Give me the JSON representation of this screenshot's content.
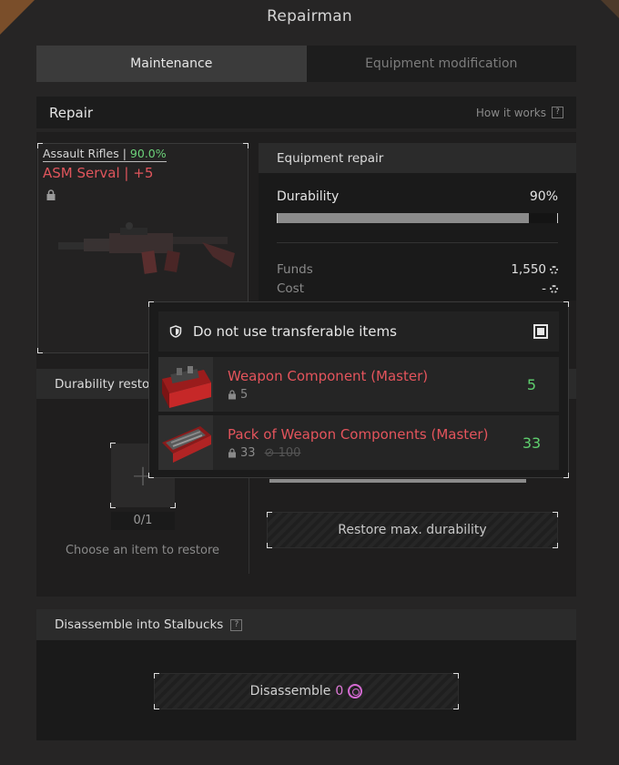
{
  "window": {
    "title": "Repairman"
  },
  "tabs": [
    {
      "label": "Maintenance",
      "active": true
    },
    {
      "label": "Equipment modification",
      "active": false
    }
  ],
  "repair": {
    "title": "Repair",
    "how_it_works": "How it works",
    "help_icon": "?"
  },
  "item": {
    "category": "Assault Rifles",
    "category_sep": " | ",
    "durability_pct": "90.0%",
    "name": "ASM Serval",
    "upgrade": " | +5",
    "image_icon": "assault-rifle-image"
  },
  "equipment_repair": {
    "title": "Equipment repair",
    "durability_label": "Durability",
    "durability_value": "90%",
    "durability_fill": 0.9,
    "funds_label": "Funds",
    "funds_value": "1,550",
    "cost_label": "Cost",
    "cost_value": "-"
  },
  "durability_restore": {
    "title": "Durability restor",
    "slot_count": "0/1",
    "choose_text": "Choose an item to restore",
    "restore_button": "Restore max. durability"
  },
  "disassemble": {
    "title": "Disassemble into Stalbucks",
    "help_icon": "?",
    "button_label": "Disassemble",
    "button_value": "0"
  },
  "popup": {
    "toggle_label": "Do not use transferable items",
    "toggle_checked": true,
    "items": [
      {
        "name": "Weapon Component (Master)",
        "locked_count": "5",
        "struck_count": "",
        "quantity": "5"
      },
      {
        "name": "Pack of Weapon Components (Master)",
        "locked_count": "33",
        "struck_count": "100",
        "quantity": "33"
      }
    ]
  },
  "colors": {
    "accent_red": "#e0555c",
    "accent_green": "#5fcf6e",
    "stalbucks_pink": "#d46ad2"
  }
}
